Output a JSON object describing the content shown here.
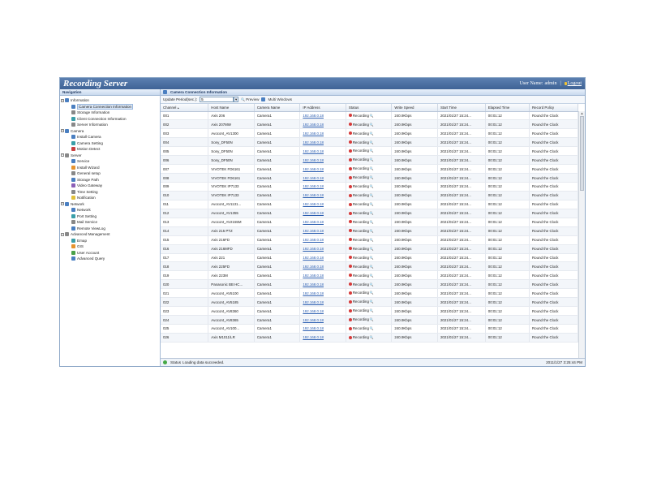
{
  "app": {
    "title": "Recording Server",
    "user_label": "User Name:",
    "user_name": "admin",
    "logout_label": "Logout"
  },
  "nav": {
    "header": "Navigation",
    "tree": [
      {
        "label": "Information",
        "group": true,
        "icon": "info-icon"
      },
      {
        "label": "Camera Connection Information",
        "group": false,
        "selected": true,
        "icon": "camera-icon"
      },
      {
        "label": "Storage Information",
        "group": false,
        "icon": "storage-icon"
      },
      {
        "label": "Client Connection Information",
        "group": false,
        "icon": "client-icon"
      },
      {
        "label": "Server Information",
        "group": false,
        "icon": "server-icon"
      },
      {
        "label": "Camera",
        "group": true,
        "icon": "camera-icon"
      },
      {
        "label": "Install Camera",
        "group": false,
        "icon": "install-icon"
      },
      {
        "label": "Camera Setting",
        "group": false,
        "icon": "settings-icon"
      },
      {
        "label": "Motion Detect",
        "group": false,
        "icon": "motion-icon"
      },
      {
        "label": "Server",
        "group": true,
        "icon": "server-icon"
      },
      {
        "label": "Service",
        "group": false,
        "icon": "service-icon"
      },
      {
        "label": "Install Wizard",
        "group": false,
        "icon": "wizard-icon"
      },
      {
        "label": "General setup",
        "group": false,
        "icon": "setup-icon"
      },
      {
        "label": "Storage Path",
        "group": false,
        "icon": "folder-icon"
      },
      {
        "label": "Video Gateway",
        "group": false,
        "icon": "gateway-icon"
      },
      {
        "label": "Time Setting",
        "group": false,
        "icon": "clock-icon"
      },
      {
        "label": "Notification",
        "group": false,
        "icon": "warning-icon"
      },
      {
        "label": "Network",
        "group": true,
        "icon": "network-icon"
      },
      {
        "label": "Network",
        "group": false,
        "icon": "network-icon"
      },
      {
        "label": "Port Setting",
        "group": false,
        "icon": "port-icon"
      },
      {
        "label": "Mail Service",
        "group": false,
        "icon": "mail-icon"
      },
      {
        "label": "Remote ViewLog",
        "group": false,
        "icon": "log-icon"
      },
      {
        "label": "Advanced Management",
        "group": true,
        "icon": "advanced-icon"
      },
      {
        "label": "Emap",
        "group": false,
        "icon": "map-icon"
      },
      {
        "label": "GIS",
        "group": false,
        "icon": "gis-icon"
      },
      {
        "label": "User Account",
        "group": false,
        "icon": "user-icon"
      },
      {
        "label": "Advanced Query",
        "group": false,
        "icon": "query-icon"
      }
    ]
  },
  "main": {
    "header": "Camera Connection Information",
    "toolbar": {
      "period_label": "Update Period(sec.):",
      "period_value": "5",
      "preview_label": "Preview",
      "multi_label": "Multi Windows"
    },
    "columns": [
      "Channel",
      "Host Name",
      "Camera Name",
      "IP Address",
      "Status",
      "Write Speed",
      "Start Time",
      "Elapsed Time",
      "Record Policy"
    ],
    "rows": [
      [
        "001",
        "Axis 206",
        "Camera1",
        "192.168.0.18",
        "Recording",
        "240.9Kbps",
        "2021/01/27 15:24...",
        "00:01:12",
        "Round the Clock"
      ],
      [
        "002",
        "Axis 207MW",
        "Camera1",
        "192.168.0.18",
        "Recording",
        "240.9Kbps",
        "2021/01/27 15:24...",
        "00:01:12",
        "Round the Clock"
      ],
      [
        "003",
        "Avocont_AV1300",
        "Camera1",
        "192.168.0.18",
        "Recording",
        "240.9Kbps",
        "2021/01/27 15:24...",
        "00:01:12",
        "Round the Clock"
      ],
      [
        "004",
        "Sony_DF50N",
        "Camera1",
        "192.168.0.18",
        "Recording",
        "240.9Kbps",
        "2021/01/27 15:24...",
        "00:01:12",
        "Round the Clock"
      ],
      [
        "005",
        "Sony_DF50N",
        "Camera1",
        "192.168.0.18",
        "Recording",
        "240.9Kbps",
        "2021/01/27 15:24...",
        "00:01:12",
        "Round the Clock"
      ],
      [
        "006",
        "Sony_DF50N",
        "Camera1",
        "192.168.0.18",
        "Recording",
        "240.9Kbps",
        "2021/01/27 15:24...",
        "00:01:12",
        "Round the Clock"
      ],
      [
        "007",
        "VIVOTEK FD6161",
        "Camera1",
        "192.168.0.18",
        "Recording",
        "240.9Kbps",
        "2021/01/27 15:24...",
        "00:01:12",
        "Round the Clock"
      ],
      [
        "008",
        "VIVOTEK FD6161",
        "Camera1",
        "192.168.0.18",
        "Recording",
        "240.9Kbps",
        "2021/01/27 15:24...",
        "00:01:12",
        "Round the Clock"
      ],
      [
        "009",
        "VIVOTEK IP7133",
        "Camera1",
        "192.168.0.18",
        "Recording",
        "240.9Kbps",
        "2021/01/27 15:24...",
        "00:01:12",
        "Round the Clock"
      ],
      [
        "010",
        "VIVOTEK IP7133",
        "Camera1",
        "192.168.0.18",
        "Recording",
        "240.9Kbps",
        "2021/01/27 15:24...",
        "00:01:12",
        "Round the Clock"
      ],
      [
        "011",
        "Avocont_AV1131...",
        "Camera1",
        "192.168.0.18",
        "Recording",
        "240.9Kbps",
        "2021/01/27 15:24...",
        "00:01:12",
        "Round the Clock"
      ],
      [
        "012",
        "Avocont_AV1355",
        "Camera1",
        "192.168.0.18",
        "Recording",
        "240.9Kbps",
        "2021/01/27 15:24...",
        "00:01:12",
        "Round the Clock"
      ],
      [
        "013",
        "Avocont_AV2155M",
        "Camera1",
        "192.168.0.18",
        "Recording",
        "240.9Kbps",
        "2021/01/27 15:24...",
        "00:01:12",
        "Round the Clock"
      ],
      [
        "014",
        "Axis 215 PTZ",
        "Camera1",
        "192.168.0.18",
        "Recording",
        "240.9Kbps",
        "2021/01/27 15:24...",
        "00:01:12",
        "Round the Clock"
      ],
      [
        "015",
        "Axis 216FD",
        "Camera1",
        "192.168.0.18",
        "Recording",
        "240.9Kbps",
        "2021/01/27 15:24...",
        "00:01:12",
        "Round the Clock"
      ],
      [
        "016",
        "Axis 216MFD",
        "Camera1",
        "192.168.0.18",
        "Recording",
        "240.9Kbps",
        "2021/01/27 15:24...",
        "00:01:12",
        "Round the Clock"
      ],
      [
        "017",
        "Axis 221",
        "Camera1",
        "192.168.0.18",
        "Recording",
        "240.9Kbps",
        "2021/01/27 15:24...",
        "00:01:12",
        "Round the Clock"
      ],
      [
        "018",
        "Axis 225FD",
        "Camera1",
        "192.168.0.18",
        "Recording",
        "240.9Kbps",
        "2021/01/27 15:24...",
        "00:01:12",
        "Round the Clock"
      ],
      [
        "019",
        "Axis 223M",
        "Camera1",
        "192.168.0.18",
        "Recording",
        "240.9Kbps",
        "2021/01/27 15:24...",
        "00:01:12",
        "Round the Clock"
      ],
      [
        "020",
        "Panasonic BB HC...",
        "Camera1",
        "192.168.0.18",
        "Recording",
        "240.9Kbps",
        "2021/01/27 15:24...",
        "00:01:12",
        "Round the Clock"
      ],
      [
        "021",
        "Avocont_AV5100",
        "Camera1",
        "192.168.0.18",
        "Recording",
        "240.9Kbps",
        "2021/01/27 15:24...",
        "00:01:12",
        "Round the Clock"
      ],
      [
        "022",
        "Avocont_AV5185",
        "Camera1",
        "192.168.0.18",
        "Recording",
        "240.9Kbps",
        "2021/01/27 15:24...",
        "00:01:12",
        "Round the Clock"
      ],
      [
        "023",
        "Avocont_AV8360",
        "Camera1",
        "192.168.0.18",
        "Recording",
        "240.9Kbps",
        "2021/01/27 15:24...",
        "00:01:12",
        "Round the Clock"
      ],
      [
        "024",
        "Avocont_AV8365",
        "Camera1",
        "192.168.0.18",
        "Recording",
        "240.9Kbps",
        "2021/01/27 15:24...",
        "00:01:12",
        "Round the Clock"
      ],
      [
        "025",
        "Avocont_AV100...",
        "Camera1",
        "192.168.0.18",
        "Recording",
        "240.9Kbps",
        "2021/01/27 15:24...",
        "00:01:12",
        "Round the Clock"
      ],
      [
        "026",
        "Axis M1011/LR",
        "Camera1",
        "192.168.0.18",
        "Recording",
        "240.9Kbps",
        "2021/01/27 15:24...",
        "00:01:12",
        "Round the Clock"
      ]
    ]
  },
  "status": {
    "label": "Status",
    "message": "Loading data succeeded.",
    "timestamp": "2011/1/27 3:25:44 PM"
  }
}
